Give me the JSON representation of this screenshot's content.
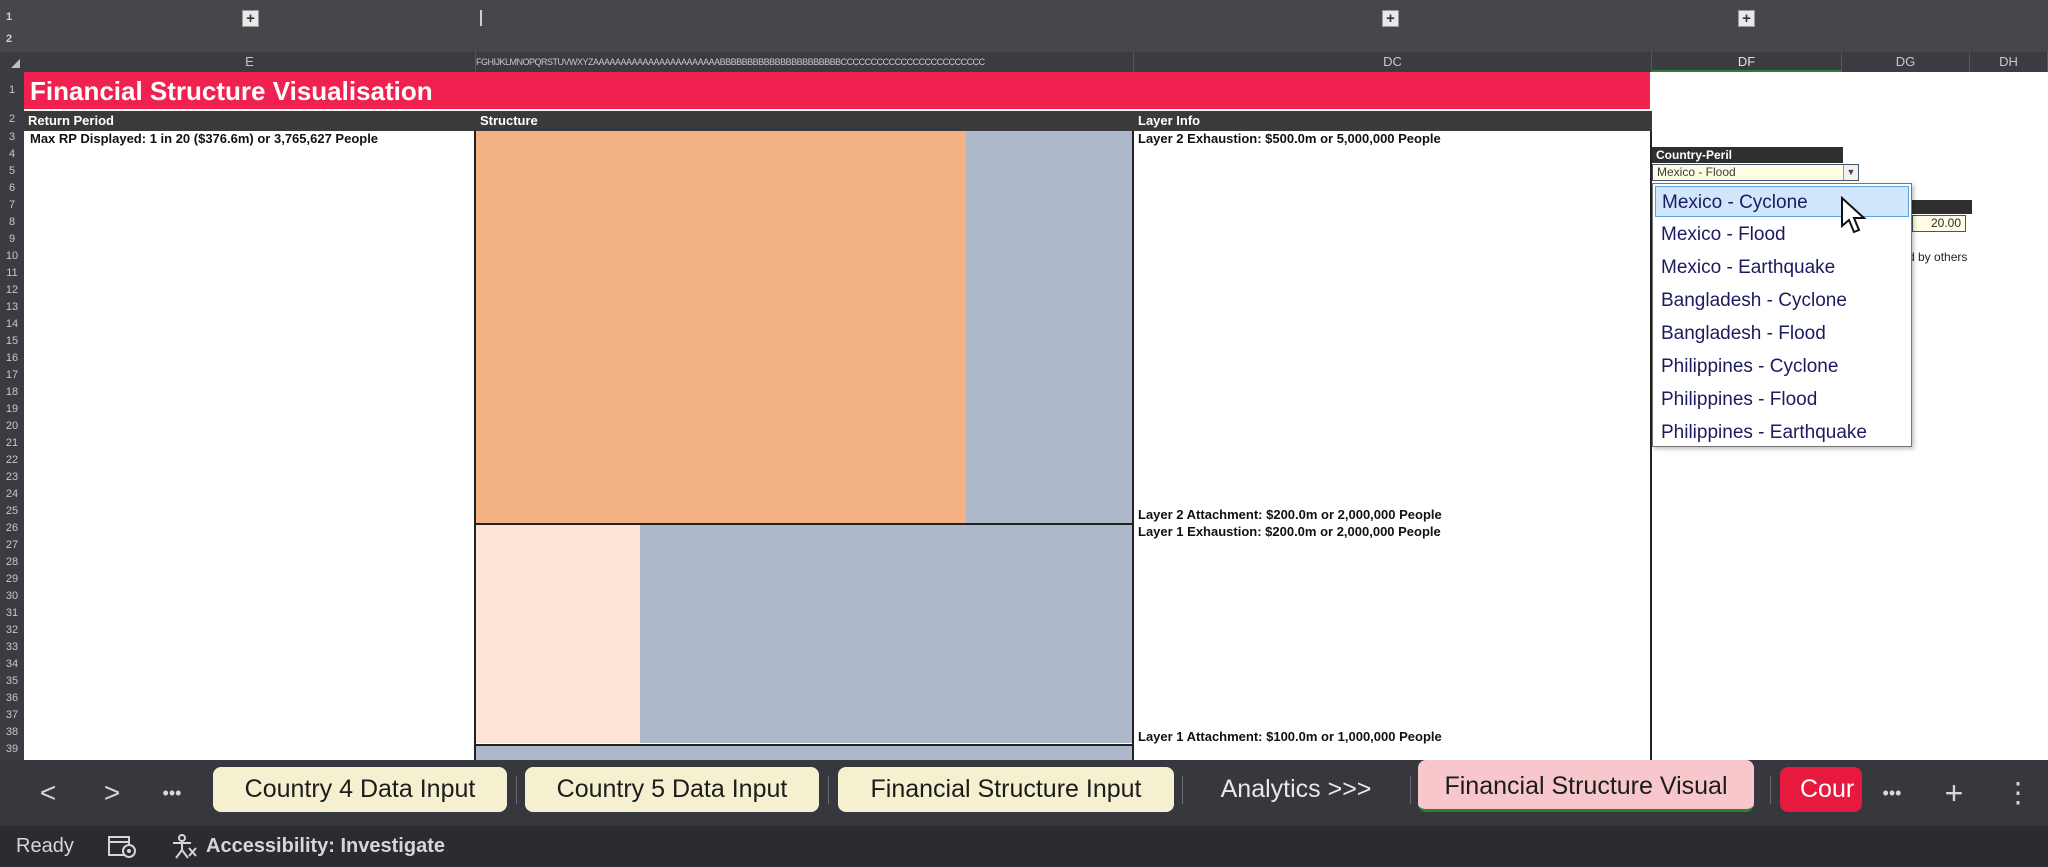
{
  "outline": {
    "levels": [
      "1",
      "2"
    ],
    "expand_symbol": "+"
  },
  "columns": {
    "e": "E",
    "compressed": "FGHIJKLMNOPQRSTUVWXYZAAAAAAAAAAAAAAAAAAAAAAABBBBBBBBBBBBBBBBBBBBBBCCCCCCCCCCCCCCCCCCCCCCCC",
    "dc": "DC",
    "df": "DF",
    "dg": "DG",
    "dh": "DH"
  },
  "rows": [
    "1",
    "2",
    "3",
    "4",
    "5",
    "6",
    "7",
    "8",
    "9",
    "10",
    "11",
    "12",
    "13",
    "14",
    "15",
    "16",
    "17",
    "18",
    "19",
    "20",
    "21",
    "22",
    "23",
    "24",
    "25",
    "26",
    "27",
    "28",
    "29",
    "30",
    "31",
    "32",
    "33",
    "34",
    "35",
    "36",
    "37",
    "38",
    "39"
  ],
  "sheet": {
    "title": "Financial Structure Visualisation",
    "headers": {
      "return_period": "Return Period",
      "structure": "Structure",
      "layer_info": "Layer Info"
    },
    "max_rp": "Max RP Displayed: 1 in 20 ($376.6m) or 3,765,627 People",
    "layer2_exhaustion": "Layer 2 Exhaustion: $500.0m  or 5,000,000 People",
    "layer2_attachment": "Layer 2 Attachment: $200.0m  or 2,000,000 People",
    "layer1_exhaustion": "Layer 1 Exhaustion: $200.0m  or 2,000,000 People",
    "layer1_attachment": "Layer 1 Attachment: $100.0m  or 1,000,000 People",
    "colors": {
      "title_band": "#f0204f",
      "layer2_covered": "#f4b183",
      "layer1_covered": "#fce4d6",
      "uncovered": "#adb9ca"
    }
  },
  "side_panel": {
    "country_peril_label": "Country-Peril",
    "country_peril_value": "Mexico - Flood",
    "value_cell": "20.00",
    "partial_text": "d by others"
  },
  "dropdown": {
    "options": [
      "Mexico - Cyclone",
      "Mexico - Flood",
      "Mexico - Earthquake",
      "Bangladesh - Cyclone",
      "Bangladesh - Flood",
      "Philippines - Cyclone",
      "Philippines - Flood",
      "Philippines - Earthquake"
    ],
    "highlighted": "Mexico - Cyclone"
  },
  "tabs": {
    "nav_prev": "<",
    "nav_next": ">",
    "more": "•••",
    "items": [
      "Country 4 Data Input",
      "Country 5 Data Input",
      "Financial Structure Input",
      "Analytics >>>",
      "Financial Structure Visual",
      "Cour"
    ],
    "add": "+",
    "options": "⋮"
  },
  "status": {
    "ready": "Ready",
    "accessibility": "Accessibility: Investigate"
  }
}
